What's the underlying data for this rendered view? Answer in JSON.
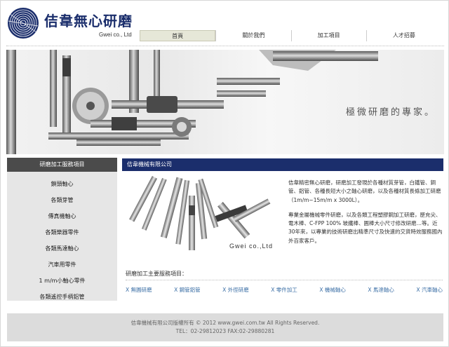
{
  "brand": {
    "name": "佶韋無心研磨",
    "subtitle": "Gwei co., Ltd",
    "logo_icon": "concentric-circle-logo",
    "color": "#1b2e6c"
  },
  "nav": {
    "items": [
      {
        "label": "首頁"
      },
      {
        "label": "關於我們"
      },
      {
        "label": "加工項目"
      },
      {
        "label": "人才招募"
      }
    ]
  },
  "banner": {
    "tagline": "極微研磨的專家。"
  },
  "sidebar": {
    "title": "研磨加工服務項目",
    "items": [
      {
        "label": "鎖頭軸心"
      },
      {
        "label": "各類芽管"
      },
      {
        "label": "傳真機軸心"
      },
      {
        "label": "各類樂器零件"
      },
      {
        "label": "各類馬達軸心"
      },
      {
        "label": "汽車用零件"
      },
      {
        "label": "1 m/m小軸心零件"
      },
      {
        "label": "各類遙控手柄鋁管"
      }
    ]
  },
  "main": {
    "header": "佶韋機械有限公司",
    "photo_caption": "Gwei co.,Ltd",
    "intro_paragraphs": [
      "佶韋精密無心研磨，研磨加工發現於各種材質芽管，白鐵管、銅管、鋁管、各種長短大小之軸心研磨，以及各種材質長條加工研磨（1m/m~15m/m x 3000L）。",
      "專業金屬機械零件研磨，以及各類工程塑膠鋼加工研磨，歷充尖、電木棒、C-FPP 100% 玻纖棒、圓棒大小尺寸修改研磨…等。近30年來，以專業的技術研磨出精準尺寸及快速的交貨時效服務國內外百家客戶。"
    ],
    "services_title": "研磨加工主要服務項目：",
    "services": [
      {
        "label": "X 無圓研磨"
      },
      {
        "label": "X 鋼管鋁管"
      },
      {
        "label": "X 外徑研磨"
      },
      {
        "label": "X 零件加工"
      },
      {
        "label": "X 機械軸心"
      },
      {
        "label": "X 馬達軸心"
      },
      {
        "label": "X 汽車軸心"
      }
    ]
  },
  "footer": {
    "copyright": "佶韋機械有限公司版權所有 © 2012 www.gwei.com.tw All Rights Reserved.",
    "contact": "TEL：02-29812023    FAX:02-29880281"
  }
}
